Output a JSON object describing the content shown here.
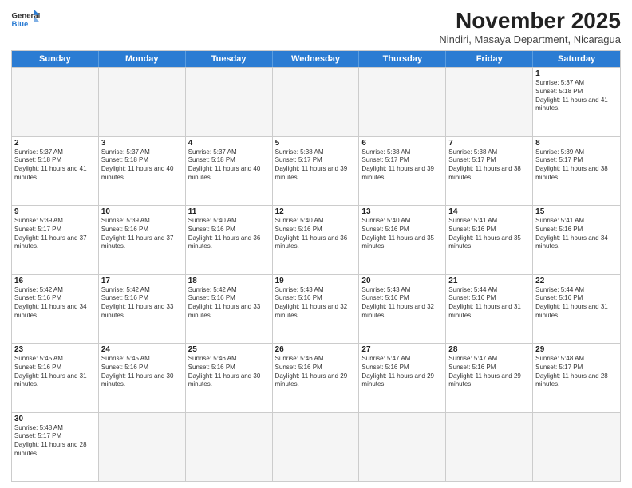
{
  "header": {
    "logo_general": "General",
    "logo_blue": "Blue",
    "month_title": "November 2025",
    "subtitle": "Nindiri, Masaya Department, Nicaragua"
  },
  "days_of_week": [
    "Sunday",
    "Monday",
    "Tuesday",
    "Wednesday",
    "Thursday",
    "Friday",
    "Saturday"
  ],
  "weeks": [
    [
      {
        "day": "",
        "sunrise": "",
        "sunset": "",
        "daylight": "",
        "empty": true
      },
      {
        "day": "",
        "sunrise": "",
        "sunset": "",
        "daylight": "",
        "empty": true
      },
      {
        "day": "",
        "sunrise": "",
        "sunset": "",
        "daylight": "",
        "empty": true
      },
      {
        "day": "",
        "sunrise": "",
        "sunset": "",
        "daylight": "",
        "empty": true
      },
      {
        "day": "",
        "sunrise": "",
        "sunset": "",
        "daylight": "",
        "empty": true
      },
      {
        "day": "",
        "sunrise": "",
        "sunset": "",
        "daylight": "",
        "empty": true
      },
      {
        "day": "1",
        "sunrise": "Sunrise: 5:37 AM",
        "sunset": "Sunset: 5:18 PM",
        "daylight": "Daylight: 11 hours and 41 minutes.",
        "empty": false
      }
    ],
    [
      {
        "day": "2",
        "sunrise": "Sunrise: 5:37 AM",
        "sunset": "Sunset: 5:18 PM",
        "daylight": "Daylight: 11 hours and 41 minutes.",
        "empty": false
      },
      {
        "day": "3",
        "sunrise": "Sunrise: 5:37 AM",
        "sunset": "Sunset: 5:18 PM",
        "daylight": "Daylight: 11 hours and 40 minutes.",
        "empty": false
      },
      {
        "day": "4",
        "sunrise": "Sunrise: 5:37 AM",
        "sunset": "Sunset: 5:18 PM",
        "daylight": "Daylight: 11 hours and 40 minutes.",
        "empty": false
      },
      {
        "day": "5",
        "sunrise": "Sunrise: 5:38 AM",
        "sunset": "Sunset: 5:17 PM",
        "daylight": "Daylight: 11 hours and 39 minutes.",
        "empty": false
      },
      {
        "day": "6",
        "sunrise": "Sunrise: 5:38 AM",
        "sunset": "Sunset: 5:17 PM",
        "daylight": "Daylight: 11 hours and 39 minutes.",
        "empty": false
      },
      {
        "day": "7",
        "sunrise": "Sunrise: 5:38 AM",
        "sunset": "Sunset: 5:17 PM",
        "daylight": "Daylight: 11 hours and 38 minutes.",
        "empty": false
      },
      {
        "day": "8",
        "sunrise": "Sunrise: 5:39 AM",
        "sunset": "Sunset: 5:17 PM",
        "daylight": "Daylight: 11 hours and 38 minutes.",
        "empty": false
      }
    ],
    [
      {
        "day": "9",
        "sunrise": "Sunrise: 5:39 AM",
        "sunset": "Sunset: 5:17 PM",
        "daylight": "Daylight: 11 hours and 37 minutes.",
        "empty": false
      },
      {
        "day": "10",
        "sunrise": "Sunrise: 5:39 AM",
        "sunset": "Sunset: 5:16 PM",
        "daylight": "Daylight: 11 hours and 37 minutes.",
        "empty": false
      },
      {
        "day": "11",
        "sunrise": "Sunrise: 5:40 AM",
        "sunset": "Sunset: 5:16 PM",
        "daylight": "Daylight: 11 hours and 36 minutes.",
        "empty": false
      },
      {
        "day": "12",
        "sunrise": "Sunrise: 5:40 AM",
        "sunset": "Sunset: 5:16 PM",
        "daylight": "Daylight: 11 hours and 36 minutes.",
        "empty": false
      },
      {
        "day": "13",
        "sunrise": "Sunrise: 5:40 AM",
        "sunset": "Sunset: 5:16 PM",
        "daylight": "Daylight: 11 hours and 35 minutes.",
        "empty": false
      },
      {
        "day": "14",
        "sunrise": "Sunrise: 5:41 AM",
        "sunset": "Sunset: 5:16 PM",
        "daylight": "Daylight: 11 hours and 35 minutes.",
        "empty": false
      },
      {
        "day": "15",
        "sunrise": "Sunrise: 5:41 AM",
        "sunset": "Sunset: 5:16 PM",
        "daylight": "Daylight: 11 hours and 34 minutes.",
        "empty": false
      }
    ],
    [
      {
        "day": "16",
        "sunrise": "Sunrise: 5:42 AM",
        "sunset": "Sunset: 5:16 PM",
        "daylight": "Daylight: 11 hours and 34 minutes.",
        "empty": false
      },
      {
        "day": "17",
        "sunrise": "Sunrise: 5:42 AM",
        "sunset": "Sunset: 5:16 PM",
        "daylight": "Daylight: 11 hours and 33 minutes.",
        "empty": false
      },
      {
        "day": "18",
        "sunrise": "Sunrise: 5:42 AM",
        "sunset": "Sunset: 5:16 PM",
        "daylight": "Daylight: 11 hours and 33 minutes.",
        "empty": false
      },
      {
        "day": "19",
        "sunrise": "Sunrise: 5:43 AM",
        "sunset": "Sunset: 5:16 PM",
        "daylight": "Daylight: 11 hours and 32 minutes.",
        "empty": false
      },
      {
        "day": "20",
        "sunrise": "Sunrise: 5:43 AM",
        "sunset": "Sunset: 5:16 PM",
        "daylight": "Daylight: 11 hours and 32 minutes.",
        "empty": false
      },
      {
        "day": "21",
        "sunrise": "Sunrise: 5:44 AM",
        "sunset": "Sunset: 5:16 PM",
        "daylight": "Daylight: 11 hours and 31 minutes.",
        "empty": false
      },
      {
        "day": "22",
        "sunrise": "Sunrise: 5:44 AM",
        "sunset": "Sunset: 5:16 PM",
        "daylight": "Daylight: 11 hours and 31 minutes.",
        "empty": false
      }
    ],
    [
      {
        "day": "23",
        "sunrise": "Sunrise: 5:45 AM",
        "sunset": "Sunset: 5:16 PM",
        "daylight": "Daylight: 11 hours and 31 minutes.",
        "empty": false
      },
      {
        "day": "24",
        "sunrise": "Sunrise: 5:45 AM",
        "sunset": "Sunset: 5:16 PM",
        "daylight": "Daylight: 11 hours and 30 minutes.",
        "empty": false
      },
      {
        "day": "25",
        "sunrise": "Sunrise: 5:46 AM",
        "sunset": "Sunset: 5:16 PM",
        "daylight": "Daylight: 11 hours and 30 minutes.",
        "empty": false
      },
      {
        "day": "26",
        "sunrise": "Sunrise: 5:46 AM",
        "sunset": "Sunset: 5:16 PM",
        "daylight": "Daylight: 11 hours and 29 minutes.",
        "empty": false
      },
      {
        "day": "27",
        "sunrise": "Sunrise: 5:47 AM",
        "sunset": "Sunset: 5:16 PM",
        "daylight": "Daylight: 11 hours and 29 minutes.",
        "empty": false
      },
      {
        "day": "28",
        "sunrise": "Sunrise: 5:47 AM",
        "sunset": "Sunset: 5:16 PM",
        "daylight": "Daylight: 11 hours and 29 minutes.",
        "empty": false
      },
      {
        "day": "29",
        "sunrise": "Sunrise: 5:48 AM",
        "sunset": "Sunset: 5:17 PM",
        "daylight": "Daylight: 11 hours and 28 minutes.",
        "empty": false
      }
    ],
    [
      {
        "day": "30",
        "sunrise": "Sunrise: 5:48 AM",
        "sunset": "Sunset: 5:17 PM",
        "daylight": "Daylight: 11 hours and 28 minutes.",
        "empty": false
      },
      {
        "day": "",
        "sunrise": "",
        "sunset": "",
        "daylight": "",
        "empty": true
      },
      {
        "day": "",
        "sunrise": "",
        "sunset": "",
        "daylight": "",
        "empty": true
      },
      {
        "day": "",
        "sunrise": "",
        "sunset": "",
        "daylight": "",
        "empty": true
      },
      {
        "day": "",
        "sunrise": "",
        "sunset": "",
        "daylight": "",
        "empty": true
      },
      {
        "day": "",
        "sunrise": "",
        "sunset": "",
        "daylight": "",
        "empty": true
      },
      {
        "day": "",
        "sunrise": "",
        "sunset": "",
        "daylight": "",
        "empty": true
      }
    ]
  ]
}
